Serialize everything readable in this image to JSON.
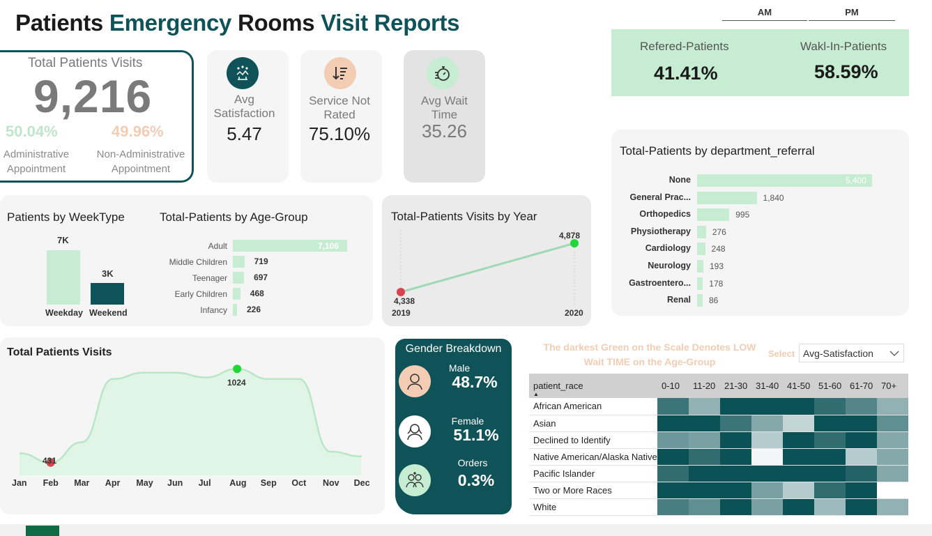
{
  "title": {
    "w1": "Patients",
    "w2": "Emergency",
    "w3": "Rooms",
    "w4": "Visit Reports"
  },
  "shift": {
    "am": "AM",
    "pm": "PM"
  },
  "total_visits": {
    "label": "Total Patients Visits",
    "value": "9,216",
    "admin_pct": "50.04%",
    "admin_label1": "Administrative",
    "admin_label2": "Appointment",
    "nonadmin_pct": "49.96%",
    "nonadmin_label1": "Non-Administrative",
    "nonadmin_label2": "Appointment"
  },
  "kpis": {
    "satisfaction": {
      "label1": "Avg",
      "label2": "Satisfaction",
      "value": "5.47",
      "icon": "rating-stars-icon"
    },
    "not_rated": {
      "label1": "Service Not",
      "label2": "Rated",
      "value": "75.10%",
      "icon": "sort-descending-icon"
    },
    "wait": {
      "label1": "Avg Wait",
      "label2": "Time",
      "value": "35.26",
      "icon": "stopwatch-icon"
    }
  },
  "referral": {
    "referred_label": "Refered-Patients",
    "referred_value": "41.41%",
    "walkin_label": "Wakl-In-Patients",
    "walkin_value": "58.59%"
  },
  "dept_chart": {
    "title": "Total-Patients by department_referral",
    "labels": [
      "None",
      "General Prac...",
      "Orthopedics",
      "Physiotherapy",
      "Cardiology",
      "Neurology",
      "Gastroentero...",
      "Renal"
    ],
    "value_labels": [
      "5,400",
      "1,840",
      "995",
      "276",
      "248",
      "193",
      "178",
      "86"
    ]
  },
  "weektype": {
    "title": "Patients by WeekType",
    "weekday_label": "Weekday",
    "weekday_value": "7K",
    "weekend_label": "Weekend",
    "weekend_value": "3K"
  },
  "age_group": {
    "title": "Total-Patients by Age-Group",
    "labels": [
      "Adult",
      "Middle Children",
      "Teenager",
      "Early Children",
      "Infancy"
    ],
    "value_labels": [
      "7,106",
      "719",
      "697",
      "468",
      "226"
    ]
  },
  "year_chart": {
    "title": "Total-Patients Visits by Year",
    "y2019": "2019",
    "y2020": "2020",
    "v2019": "4,338",
    "v2020": "4,878"
  },
  "monthly": {
    "title": "Total Patients Visits",
    "months": [
      "Jan",
      "Feb",
      "Mar",
      "Apr",
      "May",
      "Jun",
      "Jul",
      "Aug",
      "Sep",
      "Oct",
      "Nov",
      "Dec"
    ],
    "min_label": "431",
    "max_label": "1024"
  },
  "gender": {
    "title": "Gender Breakdown",
    "male_label": "Male",
    "male_value": "48.7%",
    "female_label": "Female",
    "female_value": "51.1%",
    "other_label": "Orders",
    "other_value": "0.3%"
  },
  "heatmap": {
    "note1": "The darkest Green on the Scale Denotes LOW",
    "note2": "Wait TIME on the Age-Group",
    "select_label": "Select",
    "select_value": "Avg-Satisfaction",
    "row_header": "patient_race",
    "columns": [
      "0-10",
      "11-20",
      "21-30",
      "31-40",
      "41-50",
      "51-60",
      "61-70",
      "70+"
    ],
    "rows": [
      "African American",
      "Asian",
      "Declined to Identify",
      "Native American/Alaska Native",
      "Pacific Islander",
      "Two or More Races",
      "White"
    ]
  },
  "chart_data": [
    {
      "type": "bar",
      "title": "Patients by WeekType",
      "categories": [
        "Weekday",
        "Weekend"
      ],
      "values": [
        7000,
        3000
      ]
    },
    {
      "type": "bar",
      "title": "Total-Patients by Age-Group",
      "categories": [
        "Adult",
        "Middle Children",
        "Teenager",
        "Early Children",
        "Infancy"
      ],
      "values": [
        7106,
        719,
        697,
        468,
        226
      ]
    },
    {
      "type": "line",
      "title": "Total-Patients Visits by Year",
      "x": [
        "2019",
        "2020"
      ],
      "values": [
        4338,
        4878
      ]
    },
    {
      "type": "bar",
      "title": "Total-Patients by department_referral",
      "categories": [
        "None",
        "General Prac...",
        "Orthopedics",
        "Physiotherapy",
        "Cardiology",
        "Neurology",
        "Gastroentero...",
        "Renal"
      ],
      "values": [
        5400,
        1840,
        995,
        276,
        248,
        193,
        178,
        86
      ]
    },
    {
      "type": "area",
      "title": "Total Patients Visits",
      "categories": [
        "Jan",
        "Feb",
        "Mar",
        "Apr",
        "May",
        "Jun",
        "Jul",
        "Aug",
        "Sep",
        "Oct",
        "Nov",
        "Dec"
      ],
      "values": [
        490,
        431,
        560,
        960,
        1000,
        1000,
        970,
        1024,
        960,
        960,
        500,
        470
      ]
    },
    {
      "type": "heatmap",
      "columns": [
        "0-10",
        "11-20",
        "21-30",
        "31-40",
        "41-50",
        "51-60",
        "61-70",
        "70+"
      ],
      "rows": [
        "African American",
        "Asian",
        "Declined to Identify",
        "Native American/Alaska Native",
        "Pacific Islander",
        "Two or More Races",
        "White"
      ],
      "values": [
        [
          0.8,
          0.45,
          1,
          1,
          1,
          0.85,
          0.7,
          0.45
        ],
        [
          1,
          1,
          0.8,
          0.5,
          0.25,
          1,
          1,
          0.65
        ],
        [
          0.6,
          0.55,
          1,
          0.3,
          1,
          0.85,
          1,
          0.5
        ],
        [
          1,
          0.85,
          1,
          0.05,
          1,
          1,
          0.3,
          0.5
        ],
        [
          0.85,
          1,
          1,
          1,
          1,
          1,
          0.9,
          0.5
        ],
        [
          1,
          1,
          1,
          0.55,
          0.3,
          0.85,
          1,
          0
        ],
        [
          0.75,
          0.65,
          1,
          0.55,
          1,
          0.4,
          1,
          0.45
        ]
      ]
    }
  ]
}
